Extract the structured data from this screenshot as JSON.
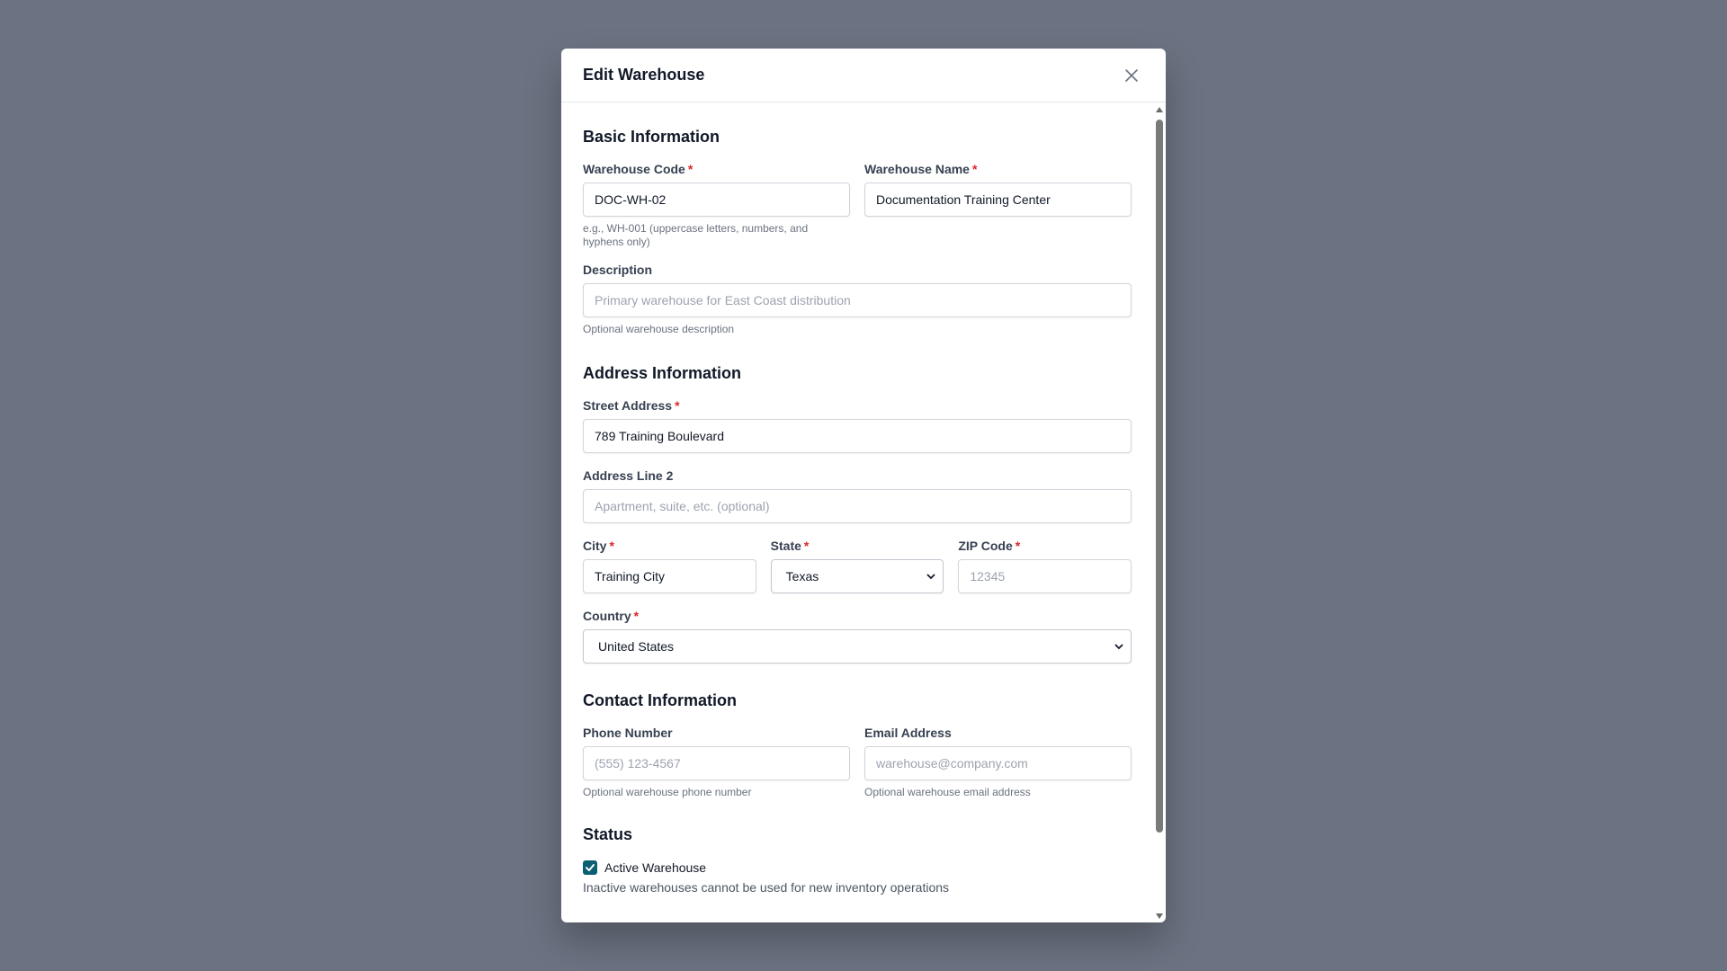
{
  "modal": {
    "title": "Edit Warehouse",
    "close_icon": "close-icon"
  },
  "basic": {
    "section_title": "Basic Information",
    "code": {
      "label": "Warehouse Code",
      "required": "*",
      "value": "DOC-WH-02",
      "hint": "e.g., WH-001 (uppercase letters, numbers, and hyphens only)"
    },
    "name": {
      "label": "Warehouse Name",
      "required": "*",
      "value": "Documentation Training Center"
    },
    "description": {
      "label": "Description",
      "placeholder": "Primary warehouse for East Coast distribution",
      "hint": "Optional warehouse description"
    }
  },
  "address": {
    "section_title": "Address Information",
    "street": {
      "label": "Street Address",
      "required": "*",
      "value": "789 Training Boulevard"
    },
    "line2": {
      "label": "Address Line 2",
      "placeholder": "Apartment, suite, etc. (optional)"
    },
    "city": {
      "label": "City",
      "required": "*",
      "value": "Training City"
    },
    "state": {
      "label": "State",
      "required": "*",
      "selected": "Texas"
    },
    "zip": {
      "label": "ZIP Code",
      "required": "*",
      "placeholder": "12345"
    },
    "country": {
      "label": "Country",
      "required": "*",
      "selected": "United States"
    }
  },
  "contact": {
    "section_title": "Contact Information",
    "phone": {
      "label": "Phone Number",
      "placeholder": "(555) 123-4567",
      "hint": "Optional warehouse phone number"
    },
    "email": {
      "label": "Email Address",
      "placeholder": "warehouse@company.com",
      "hint": "Optional warehouse email address"
    }
  },
  "status": {
    "section_title": "Status",
    "active_label": "Active Warehouse",
    "active_checked": true,
    "hint": "Inactive warehouses cannot be used for new inventory operations"
  },
  "colors": {
    "backdrop": "#6b7281",
    "checkbox": "#0b5f73",
    "required": "#dc2626"
  }
}
